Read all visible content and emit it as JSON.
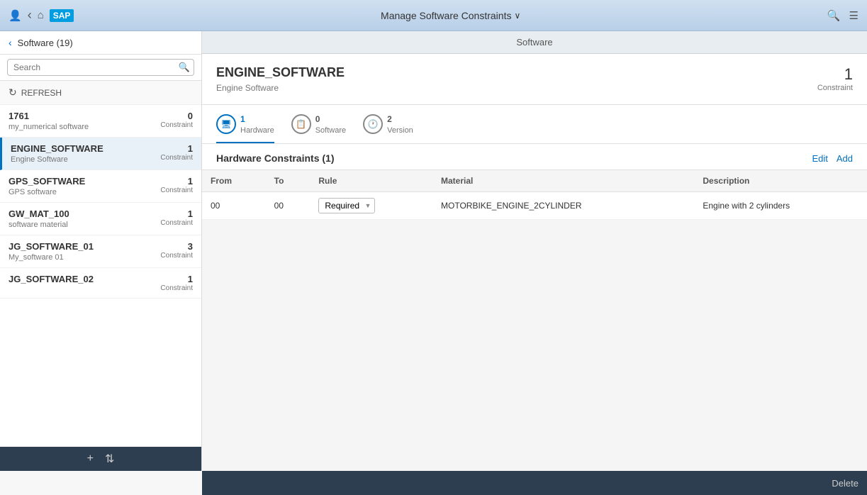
{
  "topbar": {
    "title": "Manage Software Constraints",
    "chevron": "∨",
    "icons": {
      "user": "👤",
      "back": "‹",
      "home": "⌂",
      "search": "🔍",
      "menu": "☰"
    }
  },
  "sidebar": {
    "title": "Software (19)",
    "search_placeholder": "Search",
    "refresh_label": "REFRESH",
    "items": [
      {
        "name": "1761",
        "sub": "my_numerical software",
        "count": "0",
        "constraint_label": "Constraint",
        "active": false
      },
      {
        "name": "ENGINE_SOFTWARE",
        "sub": "Engine Software",
        "count": "1",
        "constraint_label": "Constraint",
        "active": true
      },
      {
        "name": "GPS_SOFTWARE",
        "sub": "GPS software",
        "count": "1",
        "constraint_label": "Constraint",
        "active": false
      },
      {
        "name": "GW_MAT_100",
        "sub": "software material",
        "count": "1",
        "constraint_label": "Constraint",
        "active": false
      },
      {
        "name": "JG_SOFTWARE_01",
        "sub": "My_software 01",
        "count": "3",
        "constraint_label": "Constraint",
        "active": false
      },
      {
        "name": "JG_SOFTWARE_02",
        "sub": "",
        "count": "1",
        "constraint_label": "Constraint",
        "active": false
      }
    ],
    "footer": {
      "add_icon": "+",
      "sort_icon": "⇅"
    }
  },
  "content": {
    "header_title": "Software",
    "detail": {
      "title": "ENGINE_SOFTWARE",
      "subtitle": "Engine Software",
      "count": "1",
      "count_label": "Constraint"
    },
    "tabs": [
      {
        "icon": "🖥",
        "count": "1",
        "label": "Hardware",
        "active": true
      },
      {
        "icon": "📋",
        "count": "0",
        "label": "Software",
        "active": false
      },
      {
        "icon": "🕐",
        "count": "2",
        "label": "Version",
        "active": false
      }
    ],
    "constraints_section": {
      "title": "Hardware Constraints (1)",
      "edit_label": "Edit",
      "add_label": "Add",
      "table": {
        "columns": [
          "From",
          "To",
          "Rule",
          "Material",
          "Description"
        ],
        "rows": [
          {
            "from": "00",
            "to": "00",
            "rule": "Required",
            "material": "MOTORBIKE_ENGINE_2CYLINDER",
            "description": "Engine with 2 cylinders"
          }
        ]
      }
    }
  },
  "bottom_bar": {
    "delete_label": "Delete"
  }
}
